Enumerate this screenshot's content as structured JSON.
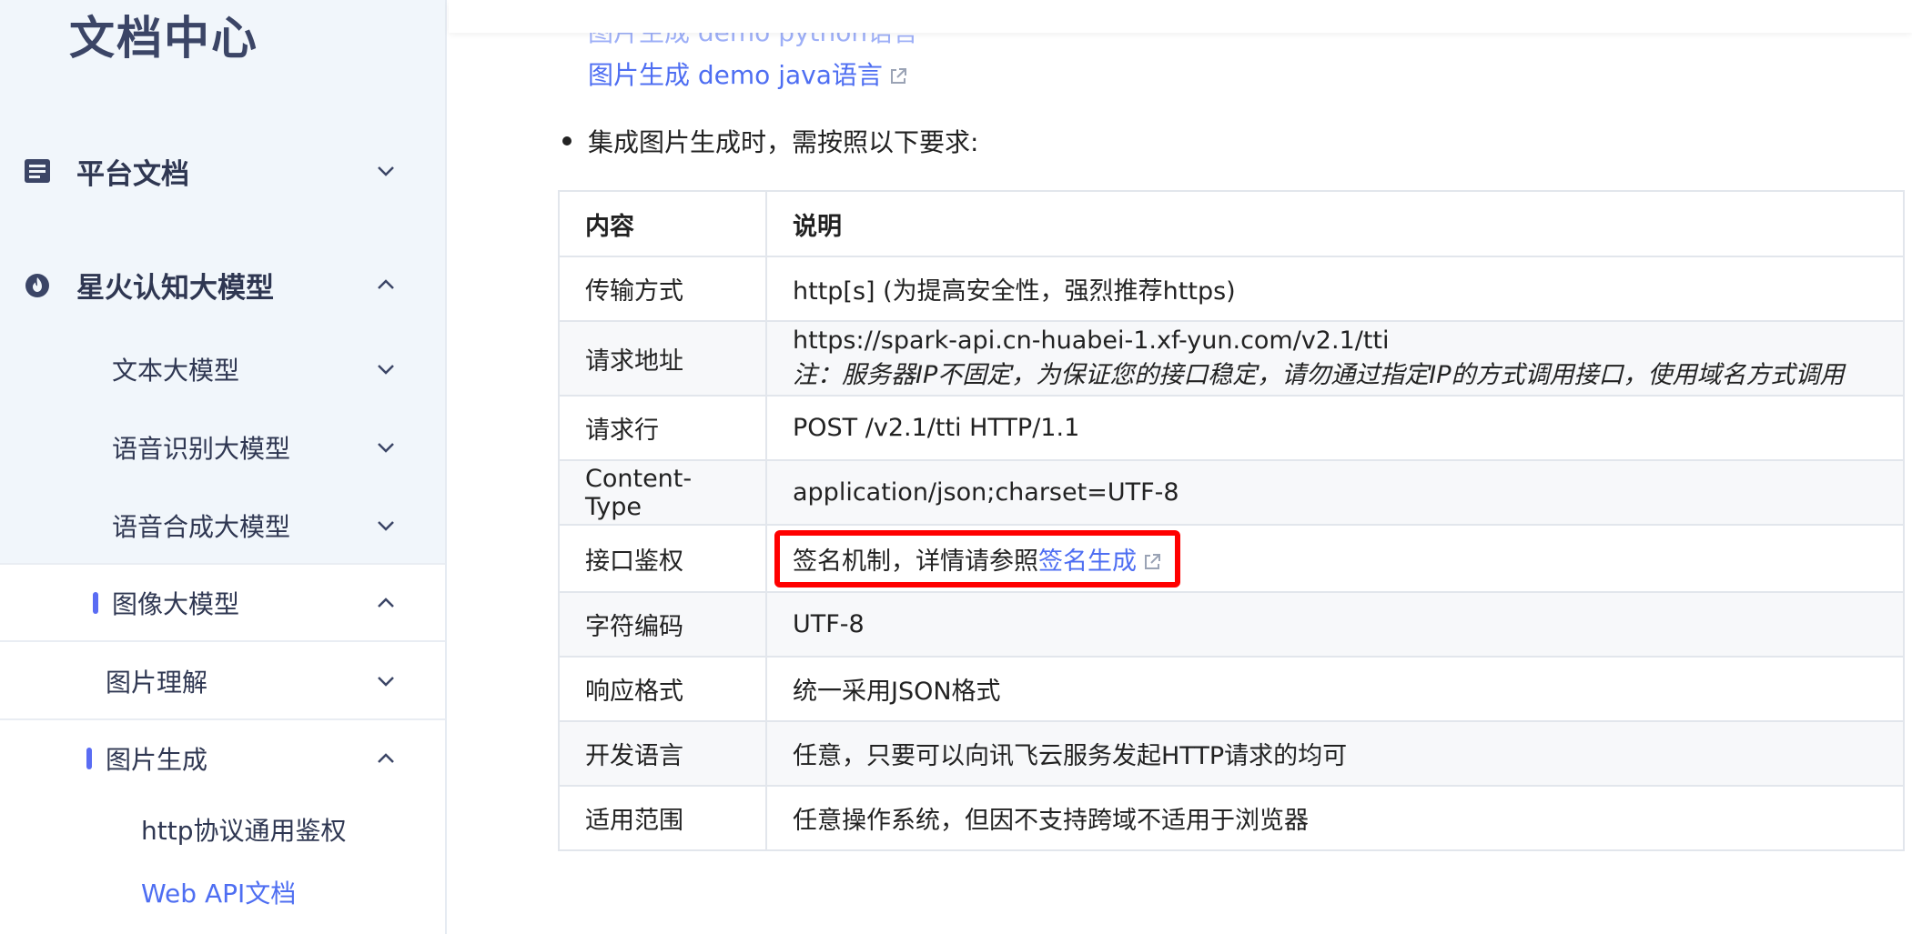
{
  "sidebar": {
    "title": "文档中心",
    "platform_docs": "平台文档",
    "spark_model": "星火认知大模型",
    "text_model": "文本大模型",
    "asr_model": "语音识别大模型",
    "tts_model": "语音合成大模型",
    "image_model": "图像大模型",
    "image_understanding": "图片理解",
    "image_generation": "图片生成",
    "http_auth": "http协议通用鉴权",
    "web_api_doc": "Web API文档"
  },
  "main": {
    "link_python_partial": "图片生成 demo python语言",
    "link_java": "图片生成 demo java语言",
    "bullet_text": "集成图片生成时，需按照以下要求:",
    "table": {
      "header_col1": "内容",
      "header_col2": "说明",
      "rows": [
        {
          "k": "传输方式",
          "v": "http[s] (为提高安全性，强烈推荐https)"
        },
        {
          "k": "请求地址",
          "v": "https://spark-api.cn-huabei-1.xf-yun.com/v2.1/tti",
          "note": "注：服务器IP不固定，为保证您的接口稳定，请勿通过指定IP的方式调用接口，使用域名方式调用"
        },
        {
          "k": "请求行",
          "v": "POST /v2.1/tti HTTP/1.1"
        },
        {
          "k": "Content-Type",
          "v": "application/json;charset=UTF-8"
        },
        {
          "k": "接口鉴权",
          "v": "签名机制，详情请参照",
          "link": "签名生成"
        },
        {
          "k": "字符编码",
          "v": "UTF-8"
        },
        {
          "k": "响应格式",
          "v": "统一采用JSON格式"
        },
        {
          "k": "开发语言",
          "v": "任意，只要可以向讯飞云服务发起HTTP请求的均可"
        },
        {
          "k": "适用范围",
          "v": "任意操作系统，但因不支持跨域不适用于浏览器"
        }
      ]
    }
  },
  "colors": {
    "accent": "#4e6ef2",
    "highlight": "#ff0000",
    "sidebar_bg": "#f1f6fb"
  }
}
